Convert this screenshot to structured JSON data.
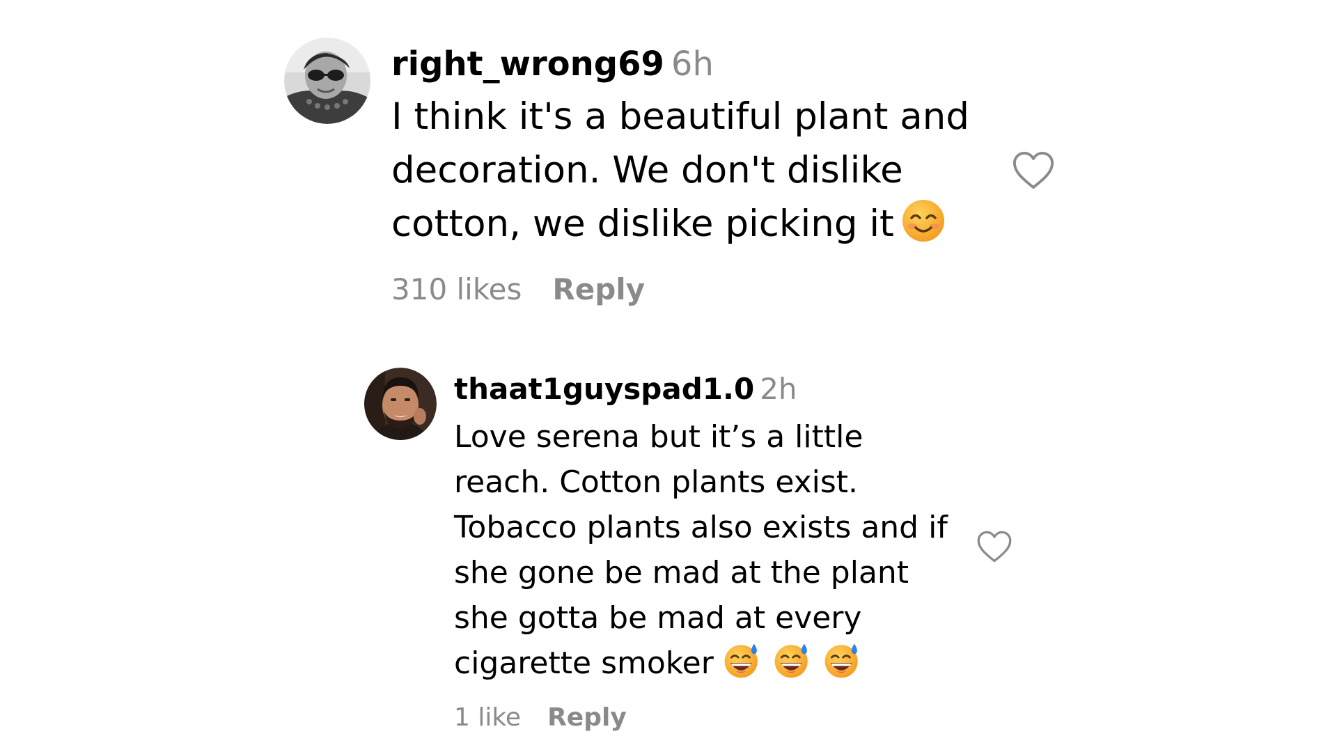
{
  "comments": [
    {
      "username": "right_wrong69",
      "time": "6h",
      "text": "I think it's a beautiful plant and decoration. We don't dislike cotton, we dislike picking it",
      "emoji_icon": "smiling-face-with-smiling-eyes",
      "likes_label": "310 likes",
      "reply_label": "Reply",
      "like_icon": "heart-outline"
    },
    {
      "username": "thaat1guyspad1.0",
      "time": "2h",
      "text": "Love serena but it’s a little reach. Cotton plants exist. Tobacco plants also exists and if she gone be mad at the plant she gotta be mad at every cigarette smoker",
      "emoji_icon": "grinning-face-with-sweat",
      "emoji_count": 3,
      "likes_label": "1 like",
      "reply_label": "Reply",
      "like_icon": "heart-outline"
    }
  ],
  "colors": {
    "text": "#000000",
    "secondary": "#8a8a8a",
    "background": "#ffffff",
    "emoji_face": "#f7b032",
    "emoji_sweat": "#2f80ed"
  }
}
